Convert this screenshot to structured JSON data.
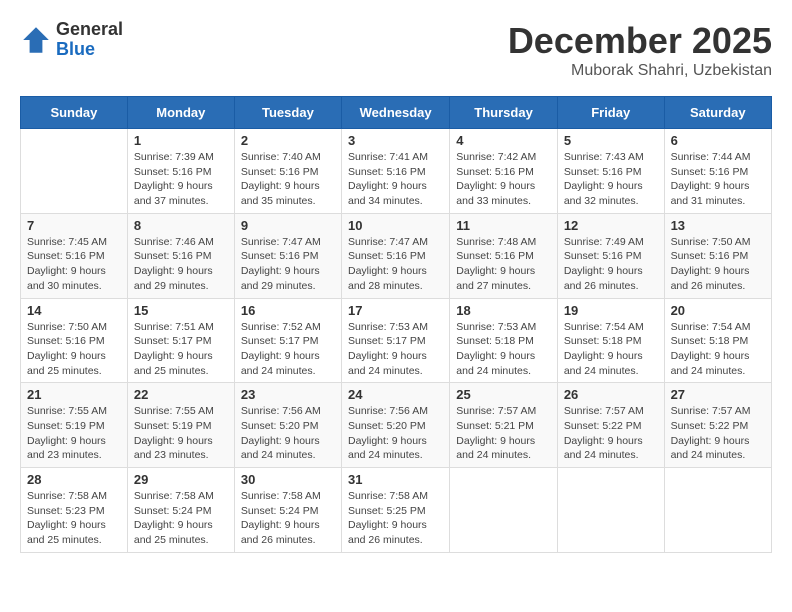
{
  "logo": {
    "general": "General",
    "blue": "Blue"
  },
  "header": {
    "month_year": "December 2025",
    "location": "Muborak Shahri, Uzbekistan"
  },
  "days_of_week": [
    "Sunday",
    "Monday",
    "Tuesday",
    "Wednesday",
    "Thursday",
    "Friday",
    "Saturday"
  ],
  "weeks": [
    [
      {
        "day": "",
        "info": ""
      },
      {
        "day": "1",
        "info": "Sunrise: 7:39 AM\nSunset: 5:16 PM\nDaylight: 9 hours\nand 37 minutes."
      },
      {
        "day": "2",
        "info": "Sunrise: 7:40 AM\nSunset: 5:16 PM\nDaylight: 9 hours\nand 35 minutes."
      },
      {
        "day": "3",
        "info": "Sunrise: 7:41 AM\nSunset: 5:16 PM\nDaylight: 9 hours\nand 34 minutes."
      },
      {
        "day": "4",
        "info": "Sunrise: 7:42 AM\nSunset: 5:16 PM\nDaylight: 9 hours\nand 33 minutes."
      },
      {
        "day": "5",
        "info": "Sunrise: 7:43 AM\nSunset: 5:16 PM\nDaylight: 9 hours\nand 32 minutes."
      },
      {
        "day": "6",
        "info": "Sunrise: 7:44 AM\nSunset: 5:16 PM\nDaylight: 9 hours\nand 31 minutes."
      }
    ],
    [
      {
        "day": "7",
        "info": "Sunrise: 7:45 AM\nSunset: 5:16 PM\nDaylight: 9 hours\nand 30 minutes."
      },
      {
        "day": "8",
        "info": "Sunrise: 7:46 AM\nSunset: 5:16 PM\nDaylight: 9 hours\nand 29 minutes."
      },
      {
        "day": "9",
        "info": "Sunrise: 7:47 AM\nSunset: 5:16 PM\nDaylight: 9 hours\nand 29 minutes."
      },
      {
        "day": "10",
        "info": "Sunrise: 7:47 AM\nSunset: 5:16 PM\nDaylight: 9 hours\nand 28 minutes."
      },
      {
        "day": "11",
        "info": "Sunrise: 7:48 AM\nSunset: 5:16 PM\nDaylight: 9 hours\nand 27 minutes."
      },
      {
        "day": "12",
        "info": "Sunrise: 7:49 AM\nSunset: 5:16 PM\nDaylight: 9 hours\nand 26 minutes."
      },
      {
        "day": "13",
        "info": "Sunrise: 7:50 AM\nSunset: 5:16 PM\nDaylight: 9 hours\nand 26 minutes."
      }
    ],
    [
      {
        "day": "14",
        "info": "Sunrise: 7:50 AM\nSunset: 5:16 PM\nDaylight: 9 hours\nand 25 minutes."
      },
      {
        "day": "15",
        "info": "Sunrise: 7:51 AM\nSunset: 5:17 PM\nDaylight: 9 hours\nand 25 minutes."
      },
      {
        "day": "16",
        "info": "Sunrise: 7:52 AM\nSunset: 5:17 PM\nDaylight: 9 hours\nand 24 minutes."
      },
      {
        "day": "17",
        "info": "Sunrise: 7:53 AM\nSunset: 5:17 PM\nDaylight: 9 hours\nand 24 minutes."
      },
      {
        "day": "18",
        "info": "Sunrise: 7:53 AM\nSunset: 5:18 PM\nDaylight: 9 hours\nand 24 minutes."
      },
      {
        "day": "19",
        "info": "Sunrise: 7:54 AM\nSunset: 5:18 PM\nDaylight: 9 hours\nand 24 minutes."
      },
      {
        "day": "20",
        "info": "Sunrise: 7:54 AM\nSunset: 5:18 PM\nDaylight: 9 hours\nand 24 minutes."
      }
    ],
    [
      {
        "day": "21",
        "info": "Sunrise: 7:55 AM\nSunset: 5:19 PM\nDaylight: 9 hours\nand 23 minutes."
      },
      {
        "day": "22",
        "info": "Sunrise: 7:55 AM\nSunset: 5:19 PM\nDaylight: 9 hours\nand 23 minutes."
      },
      {
        "day": "23",
        "info": "Sunrise: 7:56 AM\nSunset: 5:20 PM\nDaylight: 9 hours\nand 24 minutes."
      },
      {
        "day": "24",
        "info": "Sunrise: 7:56 AM\nSunset: 5:20 PM\nDaylight: 9 hours\nand 24 minutes."
      },
      {
        "day": "25",
        "info": "Sunrise: 7:57 AM\nSunset: 5:21 PM\nDaylight: 9 hours\nand 24 minutes."
      },
      {
        "day": "26",
        "info": "Sunrise: 7:57 AM\nSunset: 5:22 PM\nDaylight: 9 hours\nand 24 minutes."
      },
      {
        "day": "27",
        "info": "Sunrise: 7:57 AM\nSunset: 5:22 PM\nDaylight: 9 hours\nand 24 minutes."
      }
    ],
    [
      {
        "day": "28",
        "info": "Sunrise: 7:58 AM\nSunset: 5:23 PM\nDaylight: 9 hours\nand 25 minutes."
      },
      {
        "day": "29",
        "info": "Sunrise: 7:58 AM\nSunset: 5:24 PM\nDaylight: 9 hours\nand 25 minutes."
      },
      {
        "day": "30",
        "info": "Sunrise: 7:58 AM\nSunset: 5:24 PM\nDaylight: 9 hours\nand 26 minutes."
      },
      {
        "day": "31",
        "info": "Sunrise: 7:58 AM\nSunset: 5:25 PM\nDaylight: 9 hours\nand 26 minutes."
      },
      {
        "day": "",
        "info": ""
      },
      {
        "day": "",
        "info": ""
      },
      {
        "day": "",
        "info": ""
      }
    ]
  ]
}
